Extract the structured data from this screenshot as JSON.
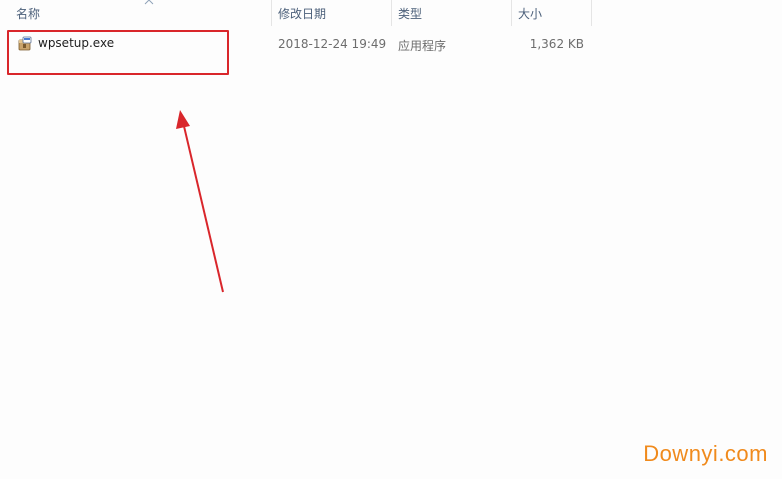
{
  "columns": {
    "name": "名称",
    "date_modified": "修改日期",
    "type": "类型",
    "size": "大小"
  },
  "sort": {
    "column": "name",
    "direction": "ascending",
    "icon": "sort-up-icon"
  },
  "files": [
    {
      "name": "wpsetup.exe",
      "date_modified": "2018-12-24 19:49",
      "type": "应用程序",
      "size": "1,362 KB",
      "icon": "installer-icon"
    }
  ],
  "annotations": {
    "highlight_color": "#d9262b",
    "arrow_color": "#d9262b"
  },
  "watermark": "Downyi.com"
}
